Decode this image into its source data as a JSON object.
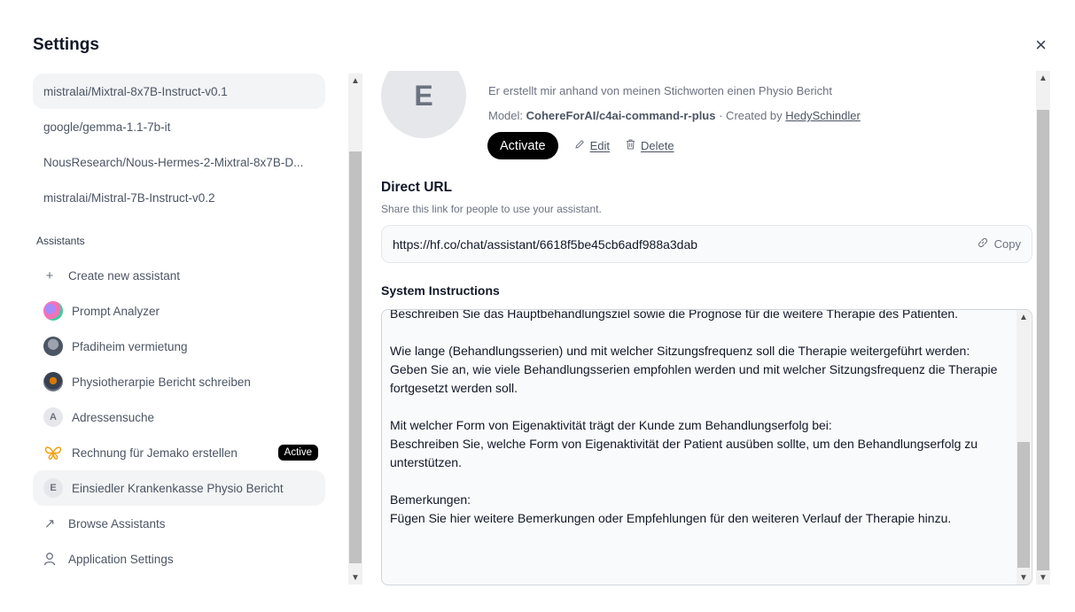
{
  "dialog": {
    "title": "Settings",
    "close_glyph": "×"
  },
  "sidebar": {
    "models": [
      {
        "label": "mistralai/Mixtral-8x7B-Instruct-v0.1",
        "selected": true
      },
      {
        "label": "google/gemma-1.1-7b-it"
      },
      {
        "label": "NousResearch/Nous-Hermes-2-Mixtral-8x7B-D..."
      },
      {
        "label": "mistralai/Mistral-7B-Instruct-v0.2"
      }
    ],
    "assistants_heading": "Assistants",
    "create_label": "Create new assistant",
    "create_glyph": "+",
    "assistants": [
      {
        "label": "Prompt Analyzer",
        "avatar": "image-avatar"
      },
      {
        "label": "Pfadiheim vermietung",
        "avatar": "image-avatar"
      },
      {
        "label": "Physiotherarpie Bericht schreiben",
        "avatar": "image-avatar"
      },
      {
        "label": "Adressensuche",
        "avatar_letter": "A"
      },
      {
        "label": "Rechnung für Jemako erstellen",
        "avatar": "butterfly-icon",
        "badge": "Active"
      },
      {
        "label": "Einsiedler Krankenkasse Physio Bericht",
        "avatar_letter": "E",
        "selected": true
      }
    ],
    "browse_label": "Browse Assistants",
    "browse_glyph": "↗",
    "app_settings_label": "Application Settings",
    "app_settings_icon": "user-icon"
  },
  "assistant": {
    "avatar_letter": "E",
    "description": "Er erstellt mir anhand von meinen Stichworten einen Physio Bericht",
    "model_prefix": "Model:",
    "model_name": "CohereForAI/c4ai-command-r-plus",
    "created_by_prefix": "· Created by",
    "creator": "HedySchindler",
    "activate_label": "Activate",
    "edit_label": "Edit",
    "delete_label": "Delete"
  },
  "direct_url": {
    "heading": "Direct URL",
    "subtitle": "Share this link for people to use your assistant.",
    "url": "https://hf.co/chat/assistant/6618f5be45cb6adf988a3dab",
    "copy_label": "Copy"
  },
  "system_instructions": {
    "heading": "System Instructions",
    "text": "Beschreiben Sie das Hauptbehandlungsziel sowie die Prognose für die weitere Therapie des Patienten.\n\nWie lange (Behandlungsserien) und mit welcher Sitzungsfrequenz soll die Therapie weitergeführt werden:\nGeben Sie an, wie viele Behandlungsserien empfohlen werden und mit welcher Sitzungsfrequenz die Therapie fortgesetzt werden soll.\n\nMit welcher Form von Eigenaktivität trägt der Kunde zum Behandlungserfolg bei:\nBeschreiben Sie, welche Form von Eigenaktivität der Patient ausüben sollte, um den Behandlungserfolg zu unterstützen.\n\nBemerkungen:\nFügen Sie hier weitere Bemerkungen oder Empfehlungen für den weiteren Verlauf der Therapie hinzu."
  }
}
